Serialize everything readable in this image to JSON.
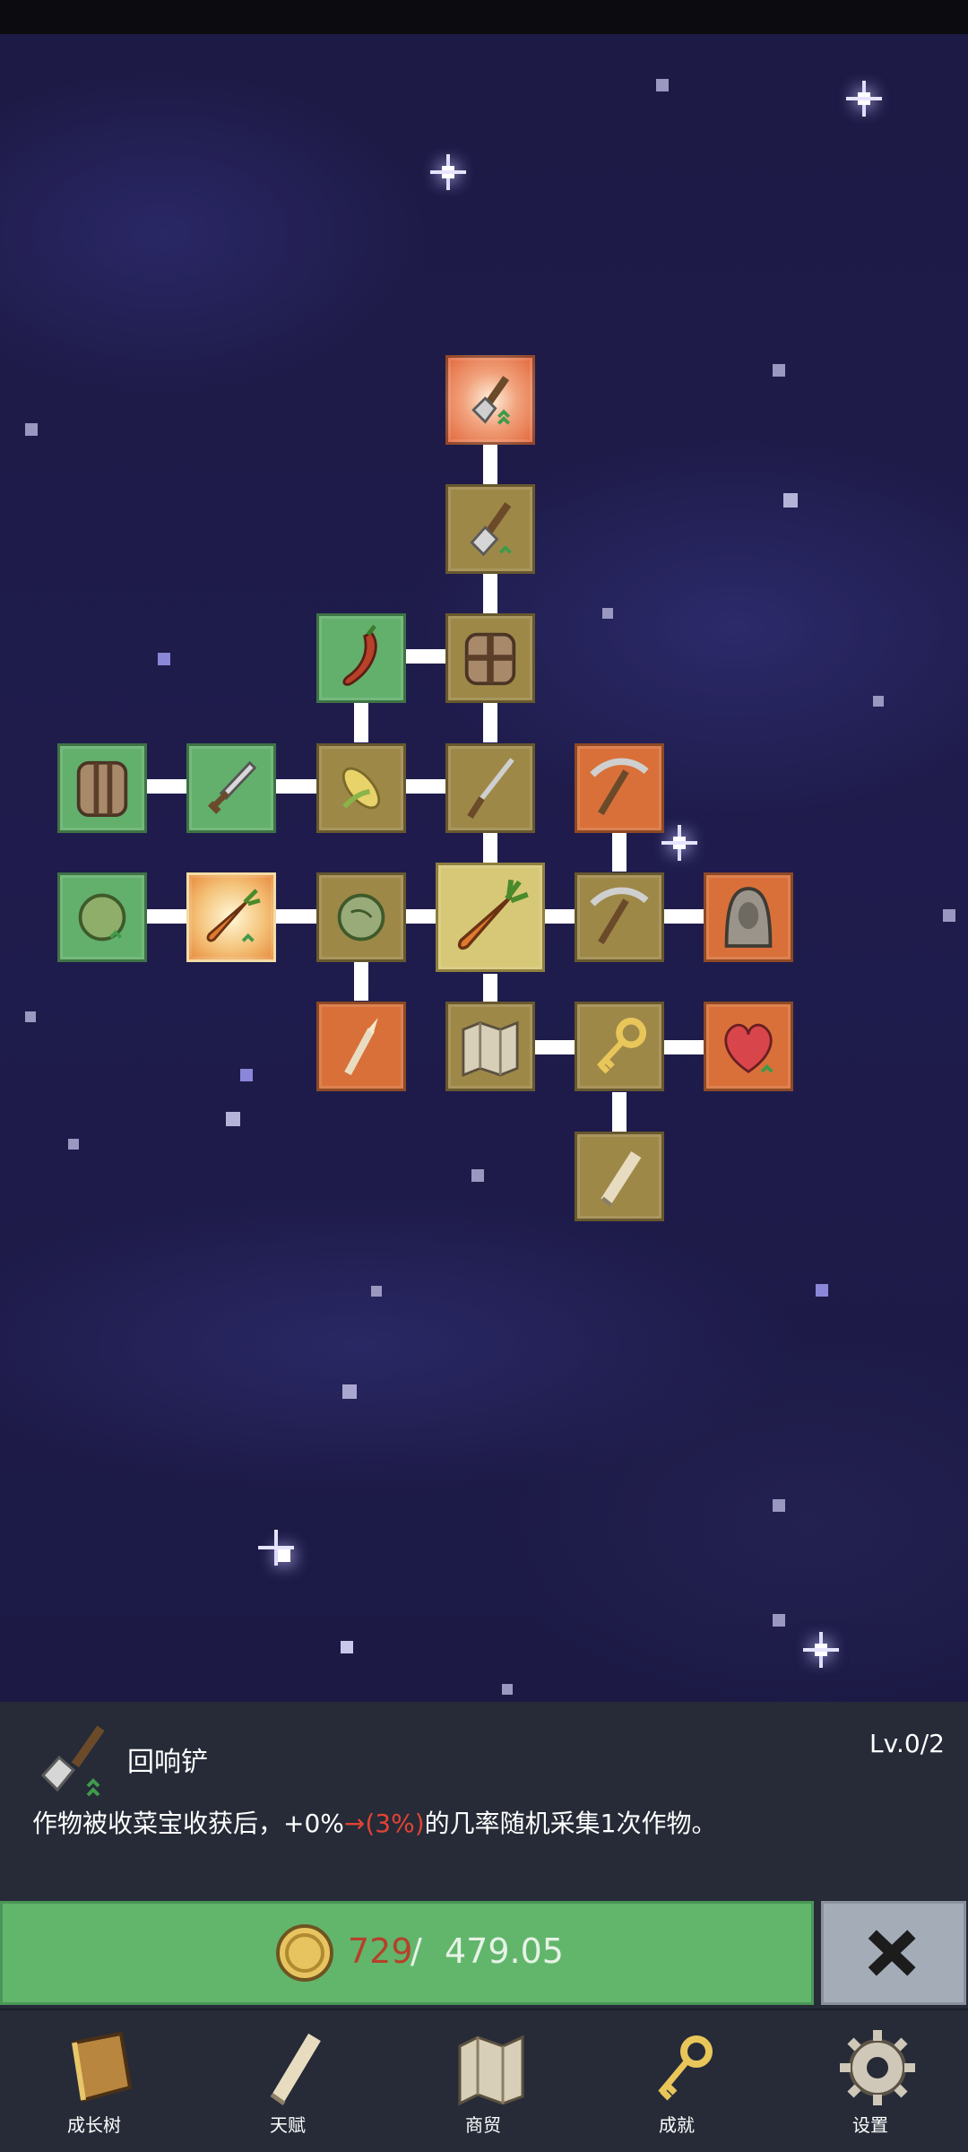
{
  "skill": {
    "name": "回响铲",
    "level": "Lv.0/2",
    "desc_before": "作物被收菜宝收获后，+0%",
    "desc_highlight": "→(3%)",
    "desc_after": "的几率随机采集1次作物。"
  },
  "purchase": {
    "have": "729",
    "separator": "/",
    "need": "479.05"
  },
  "nav": {
    "items": [
      {
        "label": "成长树",
        "icon": "book-icon"
      },
      {
        "label": "天赋",
        "icon": "scroll-icon"
      },
      {
        "label": "商贸",
        "icon": "map-icon"
      },
      {
        "label": "成就",
        "icon": "key-icon"
      },
      {
        "label": "设置",
        "icon": "gear-icon"
      }
    ]
  },
  "colors": {
    "tan_node": "#9e8848",
    "green_node": "#62b06c",
    "orange_node": "#d9703a",
    "buy_button": "#62b66c",
    "close_button": "#a4acb8",
    "cost_have": "#b5412a",
    "highlight": "#e24334"
  },
  "tree_nodes": [
    {
      "id": "echo-shovel",
      "icon": "shovel-icon",
      "state": "selected"
    },
    {
      "id": "shovel",
      "icon": "shovel-icon"
    },
    {
      "id": "chili",
      "icon": "chili-icon"
    },
    {
      "id": "backpack-top",
      "icon": "backpack-icon"
    },
    {
      "id": "backpack-left",
      "icon": "backpack-icon"
    },
    {
      "id": "sword",
      "icon": "sword-icon"
    },
    {
      "id": "corn",
      "icon": "corn-icon"
    },
    {
      "id": "sickle",
      "icon": "sickle-icon"
    },
    {
      "id": "pickaxe-top",
      "icon": "pickaxe-icon"
    },
    {
      "id": "cabbage-left",
      "icon": "cabbage-icon"
    },
    {
      "id": "carrot-glow",
      "icon": "carrot-icon"
    },
    {
      "id": "cabbage",
      "icon": "cabbage-icon"
    },
    {
      "id": "carrot-center",
      "icon": "carrot-icon"
    },
    {
      "id": "pickaxe",
      "icon": "pickaxe-icon"
    },
    {
      "id": "hooded-statue",
      "icon": "hood-icon"
    },
    {
      "id": "torch",
      "icon": "torch-icon"
    },
    {
      "id": "map",
      "icon": "map-icon"
    },
    {
      "id": "key",
      "icon": "key-icon"
    },
    {
      "id": "heart",
      "icon": "heart-icon"
    },
    {
      "id": "scroll",
      "icon": "scroll-icon"
    }
  ]
}
